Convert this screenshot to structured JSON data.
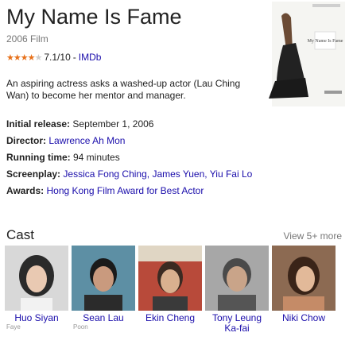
{
  "film": {
    "title": "My Name Is Fame",
    "subtitle": "2006 Film",
    "rating_text": "7.1/10",
    "rating_source": "IMDb",
    "rating_value": 3.5,
    "description": "An aspiring actress asks a washed-up actor (Lau Ching Wan) to become her mentor and manager.",
    "poster_caption": "My Name Is Fame"
  },
  "facts": [
    {
      "label": "Initial release:",
      "value": "September 1, 2006"
    },
    {
      "label": "Director:",
      "value": "Lawrence Ah Mon"
    },
    {
      "label": "Running time:",
      "value": "94 minutes"
    },
    {
      "label": "Screenplay:",
      "value": "Jessica Fong Ching, James Yuen, Yiu Fai Lo"
    },
    {
      "label": "Awards:",
      "value": "Hong Kong Film Award for Best Actor"
    }
  ],
  "cast_section": {
    "title": "Cast",
    "view_more": "View 5+ more",
    "members": [
      {
        "name": "Huo Siyan",
        "role": "Faye"
      },
      {
        "name": "Sean Lau",
        "role": "Poon"
      },
      {
        "name": "Ekin Cheng",
        "role": ""
      },
      {
        "name": "Tony Leung Ka-fai",
        "role": ""
      },
      {
        "name": "Niki Chow",
        "role": ""
      }
    ]
  },
  "colors": {
    "link": "#1a0dab",
    "muted": "#777777",
    "star": "#e7711b"
  }
}
